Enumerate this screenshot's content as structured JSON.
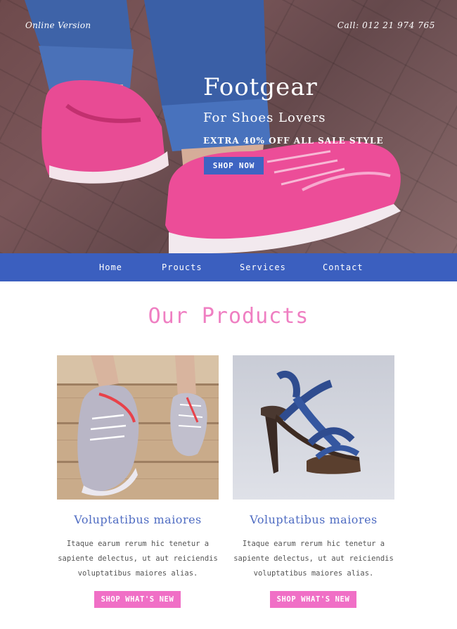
{
  "header": {
    "online_label": "Online Version",
    "call_label": "Call: 012 21 974 765"
  },
  "hero": {
    "title": "Footgear",
    "subtitle": "For Shoes Lovers",
    "extra": "EXTRA 40% OFF ALL SALE STYLE",
    "cta_label": "SHOP NOW"
  },
  "nav": {
    "items": [
      {
        "label": "Home"
      },
      {
        "label": "Proucts"
      },
      {
        "label": "Services"
      },
      {
        "label": "Contact"
      }
    ]
  },
  "products": {
    "title": "Our Products",
    "items": [
      {
        "title": "Voluptatibus maiores",
        "desc_lines": [
          "Itaque earum rerum hic tenetur a",
          "sapiente delectus, ut aut reiciendis",
          "voluptatibus maiores alias."
        ],
        "button_label": "SHOP WHAT'S NEW",
        "image": "sneakers-on-wood-photo"
      },
      {
        "title": "Voluptatibus maiores",
        "desc_lines": [
          "Itaque earum rerum hic tenetur a",
          "sapiente delectus, ut aut reiciendis",
          "voluptatibus maiores alias."
        ],
        "button_label": "SHOP WHAT'S NEW",
        "image": "blue-strappy-heel-photo"
      }
    ]
  },
  "colors": {
    "nav_blue": "#3b5fbf",
    "button_blue": "#3e64c2",
    "accent_pink": "#ef7fc2",
    "button_pink": "#f06fc6",
    "product_title_blue": "#4f6cc2"
  }
}
